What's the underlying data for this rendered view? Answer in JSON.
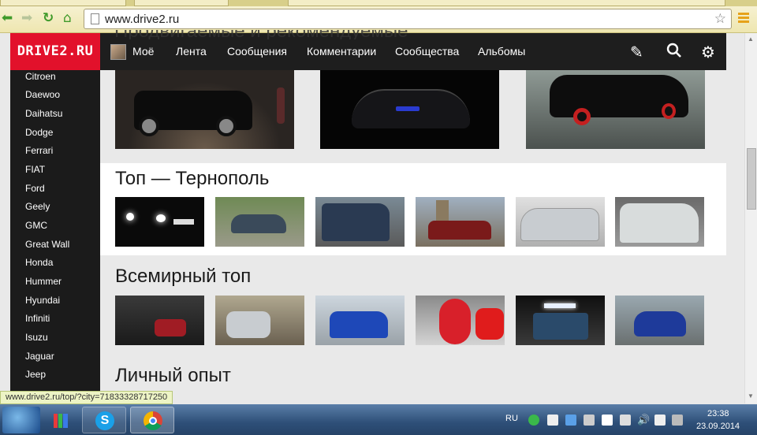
{
  "browser": {
    "url": "www.drive2.ru",
    "status_url": "www.drive2.ru/top/?city=71833328717250"
  },
  "header": {
    "logo": "DRIVE2.RU",
    "nav": [
      "Моё",
      "Лента",
      "Сообщения",
      "Комментарии",
      "Сообщества",
      "Альбомы"
    ],
    "ghost_title": "Продвигаемые и рекомендуемые"
  },
  "sidebar": {
    "items": [
      "Citroen",
      "Daewoo",
      "Daihatsu",
      "Dodge",
      "Ferrari",
      "FIAT",
      "Ford",
      "Geely",
      "GMC",
      "Great Wall",
      "Honda",
      "Hummer",
      "Hyundai",
      "Infiniti",
      "Isuzu",
      "Jaguar",
      "Jeep"
    ]
  },
  "sections": {
    "ternopol_title": "Топ — Тернополь",
    "world_title": "Всемирный топ",
    "personal_title": "Личный опыт"
  },
  "taskbar": {
    "lang": "RU",
    "time": "23:38",
    "date": "23.09.2014"
  }
}
